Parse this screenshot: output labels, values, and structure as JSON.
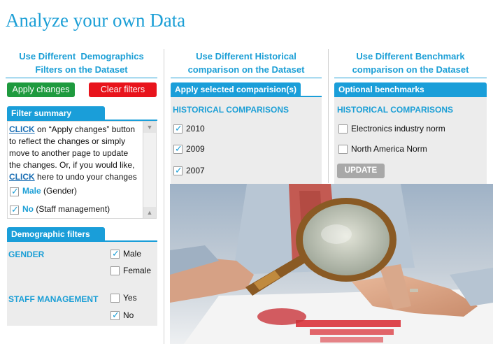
{
  "title": "Analyze your own Data",
  "columns": {
    "demographics": {
      "heading_line1": "Use Different  Demographics",
      "heading_line2": "Filters on the Dataset"
    },
    "historical": {
      "heading_line1": "Use Different Historical",
      "heading_line2": "comparison on the Dataset"
    },
    "benchmark": {
      "heading_line1": "Use Different Benchmark",
      "heading_line2": "comparison on the Dataset"
    }
  },
  "buttons": {
    "apply_changes": "Apply changes",
    "clear_filters": "Clear filters",
    "apply_selected": "Apply selected comparision(s)",
    "update": "UPDATE"
  },
  "colors": {
    "accent": "#1c9fd6",
    "apply_green": "#1e9a3e",
    "clear_red": "#e8141c"
  },
  "filter_summary": {
    "title": "Filter summary",
    "click1": "CLICK",
    "text1": " on “Apply changes” button",
    "line2": "to reflect the changes or simply",
    "line3": "move to another page to update",
    "line4": "the changes. Or, if you would like,",
    "click2": "CLICK",
    "text2": " here to undo your changes",
    "items": [
      {
        "value": "Male",
        "category": " (Gender)"
      },
      {
        "value": "No",
        "category": " (Staff management)"
      }
    ]
  },
  "demographic_filters": {
    "title": "Demographic filters",
    "gender": {
      "label": "GENDER",
      "options": [
        "Male",
        "Female"
      ]
    },
    "staff": {
      "label": "STAFF MANAGEMENT",
      "options": [
        "Yes",
        "No"
      ]
    }
  },
  "historical": {
    "section_label": "HISTORICAL COMPARISONS",
    "options": [
      "2010",
      "2009",
      "2007"
    ]
  },
  "benchmarks": {
    "title": "Optional benchmarks",
    "section_label": "HISTORICAL COMPARISONS",
    "options": [
      "Electronics industry norm",
      "North America Norm"
    ]
  }
}
